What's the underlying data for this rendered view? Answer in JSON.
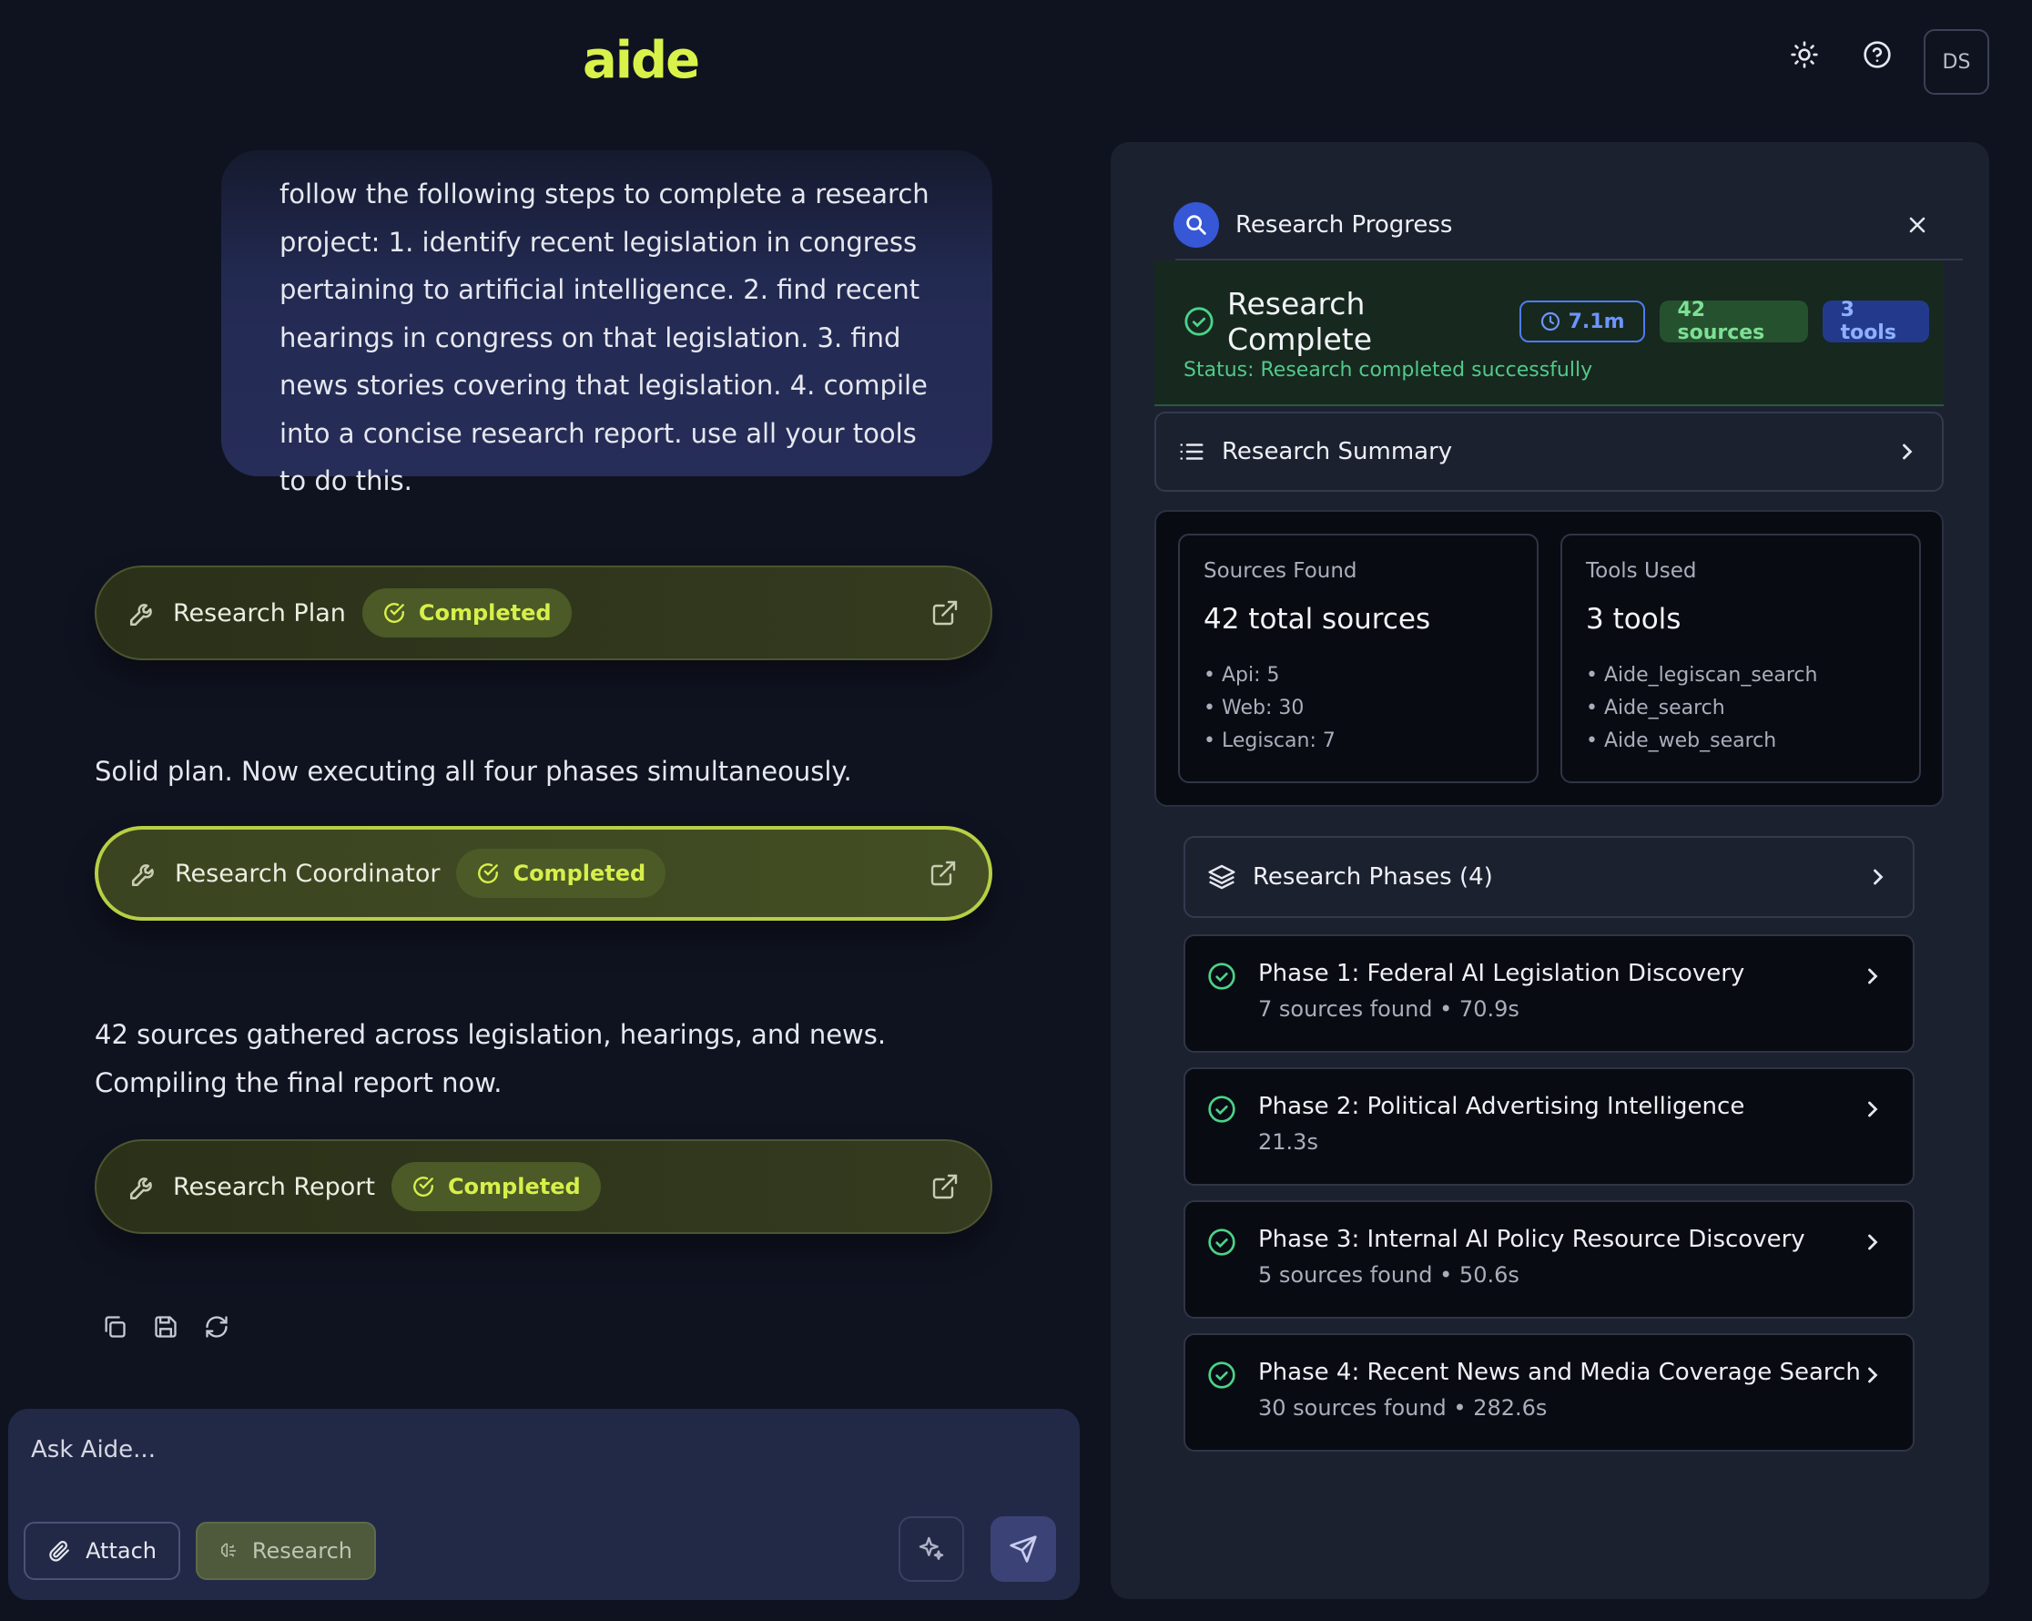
{
  "app": {
    "logo": "aide",
    "user_initials": "DS"
  },
  "chat": {
    "user_message": "follow the following steps to complete a research project: 1. identify recent legislation in congress pertaining to artificial intelligence. 2. find recent hearings in congress on that legislation. 3. find news stories covering that legislation. 4. compile into a concise research report. use all your tools to do this.",
    "tools": [
      {
        "name": "Research Plan",
        "status": "Completed"
      },
      {
        "name": "Research Coordinator",
        "status": "Completed"
      },
      {
        "name": "Research Report",
        "status": "Completed"
      }
    ],
    "assistant_messages": [
      "Solid plan. Now executing all four phases simultaneously.",
      "42 sources gathered across legislation, hearings, and news. Compiling the final report now."
    ]
  },
  "composer": {
    "placeholder": "Ask Aide...",
    "attach_label": "Attach",
    "research_label": "Research"
  },
  "panel": {
    "title": "Research Progress",
    "complete_title": "Research Complete",
    "time_chip": "7.1m",
    "sources_chip": "42 sources",
    "tools_chip": "3 tools",
    "status_text": "Status: Research completed successfully",
    "summary_title": "Research Summary",
    "sources_card": {
      "label": "Sources Found",
      "total": "42 total sources",
      "items": [
        "Api: 5",
        "Web: 30",
        "Legiscan: 7"
      ]
    },
    "tools_card": {
      "label": "Tools Used",
      "total": "3 tools",
      "items": [
        "Aide_legiscan_search",
        "Aide_search",
        "Aide_web_search"
      ]
    },
    "phases_title": "Research Phases (4)",
    "phases": [
      {
        "title": "Phase 1: Federal AI Legislation Discovery",
        "detail": "7 sources found • 70.9s"
      },
      {
        "title": "Phase 2: Political Advertising Intelligence",
        "detail": "21.3s"
      },
      {
        "title": "Phase 3: Internal AI Policy Resource Discovery",
        "detail": "5 sources found • 50.6s"
      },
      {
        "title": "Phase 4: Recent News and Media Coverage Search",
        "detail": "30 sources found • 282.6s"
      }
    ]
  },
  "colors": {
    "accent": "#d9f24a",
    "success": "#4ad38a",
    "background": "#0f1320",
    "panel": "#1c2130"
  }
}
